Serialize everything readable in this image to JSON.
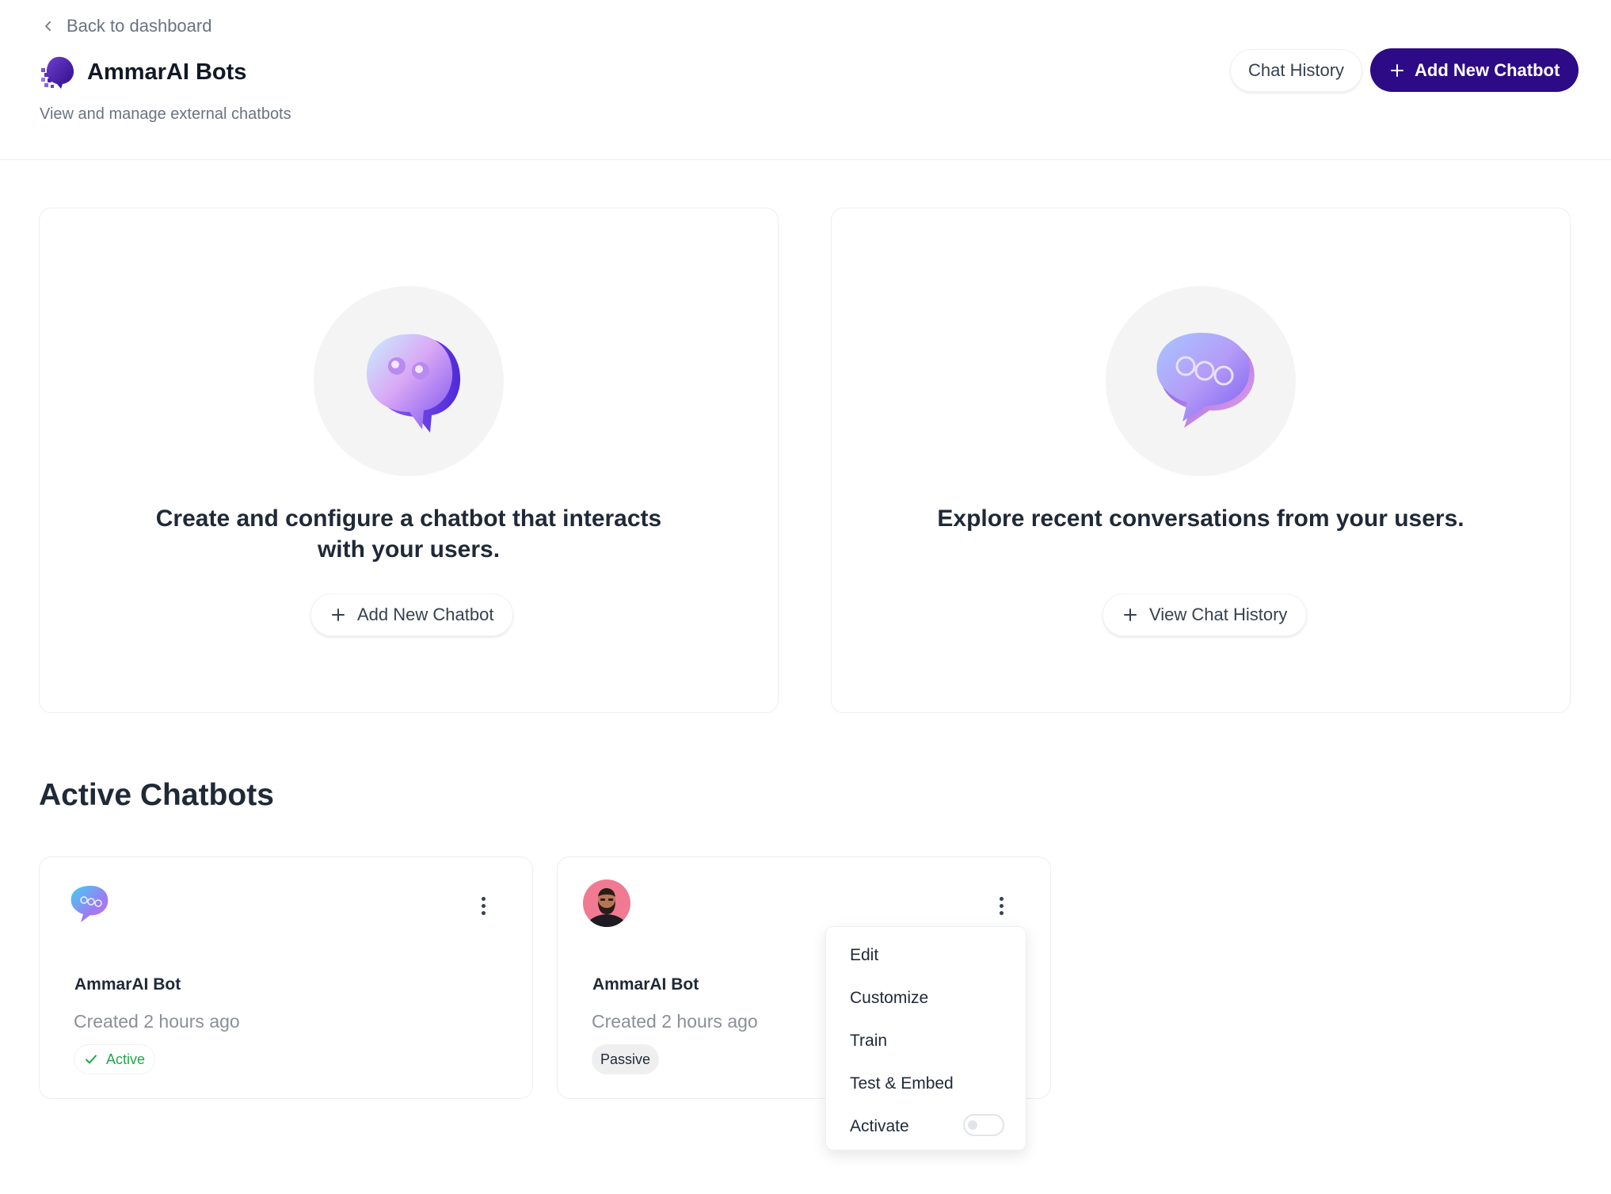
{
  "header": {
    "back_label": "Back to dashboard",
    "title": "AmmarAI Bots",
    "subtitle": "View and manage external chatbots",
    "chat_history_label": "Chat History",
    "add_button_label": "Add New Chatbot"
  },
  "feature_cards": [
    {
      "text": "Create and configure a chatbot that interacts with your users.",
      "button_label": "Add New Chatbot",
      "icon": "chat-bubble-dots-icon"
    },
    {
      "text": "Explore recent conversations from your users.",
      "button_label": "View Chat History",
      "icon": "chat-bubble-ellipsis-icon"
    }
  ],
  "active_section": {
    "title": "Active Chatbots"
  },
  "bots": [
    {
      "name": "AmmarAI Bot",
      "created": "Created 2 hours ago",
      "status": "Active",
      "avatar": "chat-bubble-avatar"
    },
    {
      "name": "AmmarAI Bot",
      "created": "Created 2 hours ago",
      "status": "Passive",
      "avatar": "person-avatar"
    }
  ],
  "dropdown": {
    "items": [
      "Edit",
      "Customize",
      "Train",
      "Test & Embed",
      "Activate"
    ],
    "activate_on": false
  },
  "colors": {
    "primary": "#2e0b86",
    "active_green": "#22a54a",
    "passive_bg": "#efefef"
  }
}
